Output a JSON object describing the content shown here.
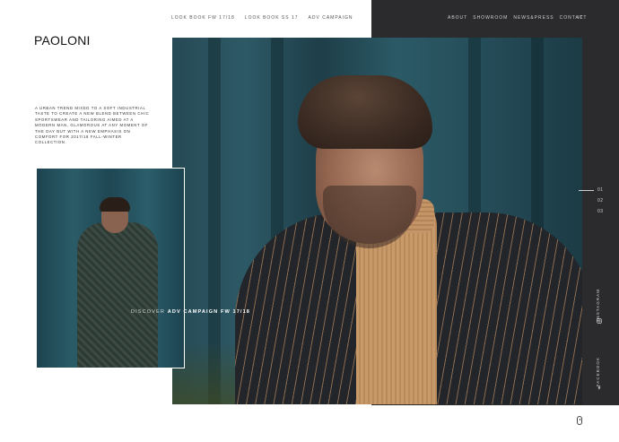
{
  "brand": {
    "logo": "PAOLONI"
  },
  "nav_center": [
    "LOOK BOOK FW 17/18",
    "LOOK BOOK SS 17",
    "ADV CAMPAIGN"
  ],
  "nav_right": [
    "ABOUT",
    "SHOWROOM",
    "NEWS&PRESS",
    "CONTACT"
  ],
  "language": "IT",
  "intro_text": "A URBAN TREND MIXED TO A SOFT INDUSTRIAL TASTE TO CREATE A NEW BLEND BETWEEN CHIC SPORTSWEAR AND TAILORING AIMED AT A MODERN MAN, GLAMOROUS AT ANY MOMENT OF THE DAY BUT WITH A NEW EMPHASIS ON COMFORT FOR 2017/18 FALL-WINTER COLLECTION.",
  "discover": {
    "lead": "DISCOVER",
    "link": "ADV CAMPAIGN FW 17/18"
  },
  "slider": {
    "pages": [
      "01",
      "02",
      "03"
    ],
    "current": "01"
  },
  "social": {
    "instagram": "INSTAGRAM",
    "facebook": "FACEBOOK"
  },
  "icons": {
    "instagram": "instagram-icon",
    "facebook": "facebook-icon",
    "scroll": "mouse-scroll-icon"
  },
  "colors": {
    "dark_panel": "#2b2b2d",
    "background": "#ffffff"
  }
}
